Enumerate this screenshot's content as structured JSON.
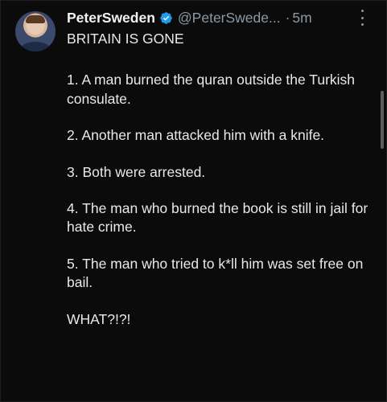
{
  "tweet": {
    "author_name": "PeterSweden",
    "handle": "@PeterSwede...",
    "separator": "·",
    "time": "5m",
    "verified_color": "#1d9bf0",
    "avatar_icon": "user-photo",
    "more_icon": "vertical-ellipsis",
    "lines": [
      "BRITAIN IS GONE",
      "1. A man burned the quran outside the Turkish consulate.",
      "2. Another man attacked him with a knife.",
      "3. Both were arrested.",
      "4. The man who burned the book is still in jail for hate crime.",
      "5. The man who tried to k*ll him was set free on bail.",
      "WHAT?!?!"
    ]
  }
}
